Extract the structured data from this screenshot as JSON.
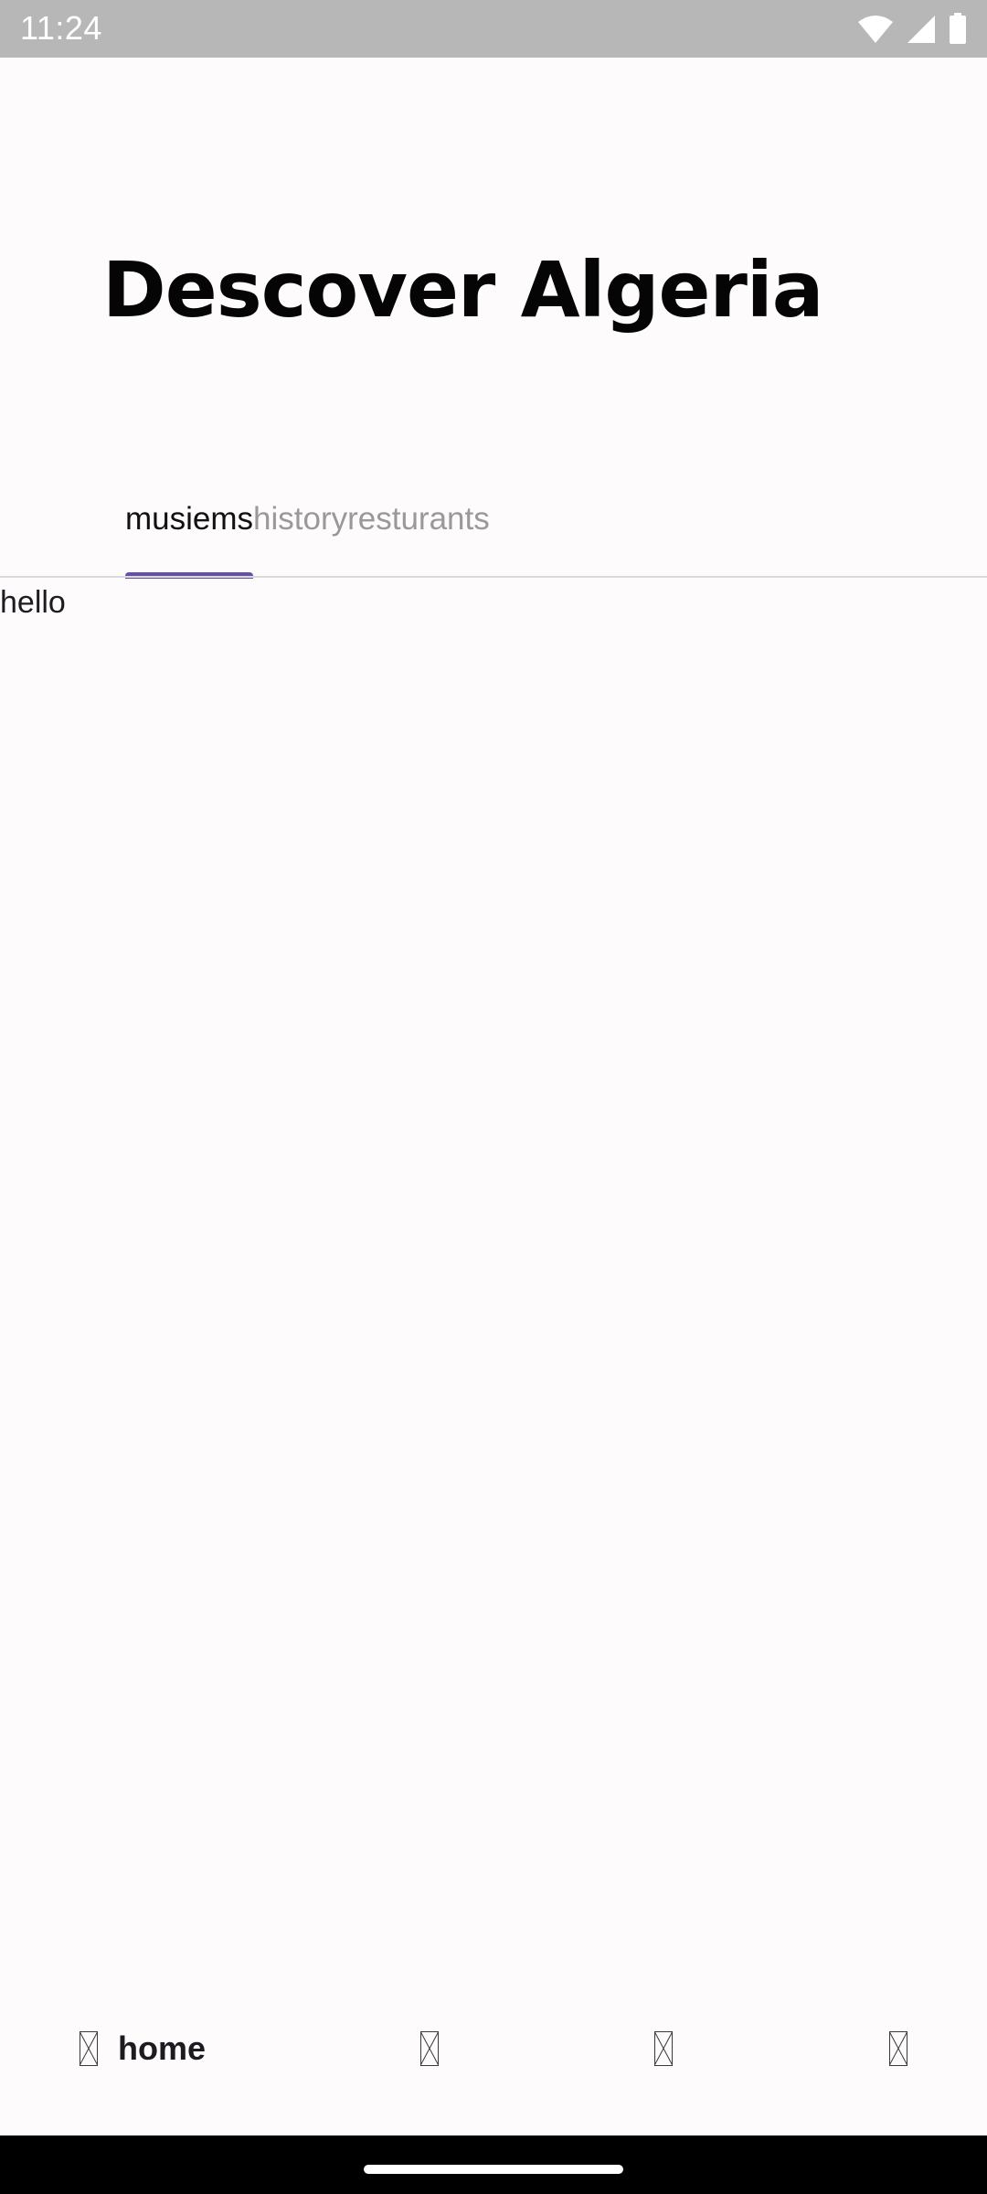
{
  "status_bar": {
    "time": "11:24",
    "icons": [
      "wifi-icon",
      "signal-icon",
      "battery-icon"
    ]
  },
  "page": {
    "title": "Descover Algeria"
  },
  "tabs": [
    {
      "label": "musiems",
      "selected": true
    },
    {
      "label": "history",
      "selected": false
    },
    {
      "label": "resturants",
      "selected": false
    }
  ],
  "content": {
    "text": "hello"
  },
  "bottom_nav": {
    "items": [
      {
        "label": "home",
        "icon": "missing-glyph-icon",
        "selected": true
      },
      {
        "label": "",
        "icon": "missing-glyph-icon",
        "selected": false
      },
      {
        "label": "",
        "icon": "missing-glyph-icon",
        "selected": false
      },
      {
        "label": "",
        "icon": "missing-glyph-icon",
        "selected": false
      }
    ]
  },
  "colors": {
    "background": "#fefbfd",
    "status_bar": "#b8b7b8",
    "tab_indicator": "#6750a4",
    "tab_active_text": "#111111",
    "tab_inactive_text": "#9a9899",
    "divider": "#dcd9de",
    "gesture_area": "#000000"
  }
}
